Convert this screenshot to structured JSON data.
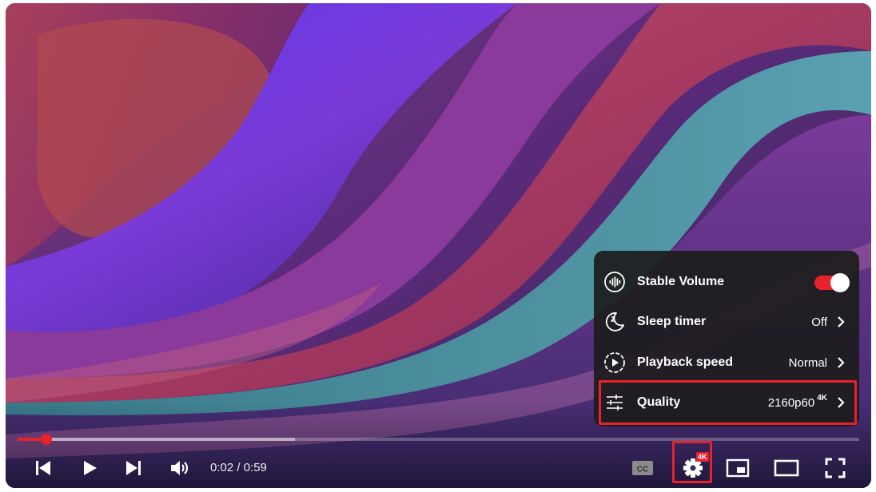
{
  "colors": {
    "accent": "#e8222a",
    "menu_bg": "#1c1c1c",
    "text": "#ffffff"
  },
  "progress": {
    "played_fraction": 0.034,
    "buffered_fraction": 0.33
  },
  "time": {
    "current": "0:02",
    "separator": "/",
    "duration": "0:59",
    "display": "0:02 / 0:59"
  },
  "controls": {
    "previous_icon": "skip-previous-icon",
    "play_icon": "play-icon",
    "next_icon": "skip-next-icon",
    "volume_icon": "volume-icon",
    "captions_icon": "closed-captions-icon",
    "settings_icon": "gear-icon",
    "settings_badge": "4K",
    "miniplayer_icon": "miniplayer-icon",
    "theater_icon": "theater-mode-icon",
    "fullscreen_icon": "fullscreen-icon"
  },
  "settings_menu": {
    "items": [
      {
        "label": "Stable Volume",
        "value": "",
        "icon": "waveform-icon",
        "toggle": true,
        "toggle_on": true
      },
      {
        "label": "Sleep timer",
        "value": "Off",
        "icon": "sleep-timer-icon"
      },
      {
        "label": "Playback speed",
        "value": "Normal",
        "icon": "playback-speed-icon"
      },
      {
        "label": "Quality",
        "value": "2160p60",
        "value_sup": "4K",
        "icon": "sliders-icon",
        "highlighted": true
      }
    ]
  }
}
